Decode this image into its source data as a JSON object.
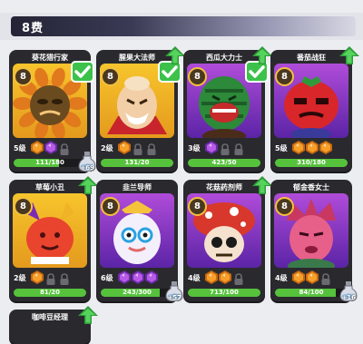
{
  "header": {
    "title": "8费"
  },
  "colors": {
    "gold_bg": "#f0b227",
    "purple_bg": "#8a3ac5",
    "green": "#3cc24a",
    "card_bg": "#2a2a2e"
  },
  "cards": [
    {
      "name": "葵花猎行家",
      "cost": "8",
      "level": "5级",
      "progress_text": "111/180",
      "progress": 0.62,
      "owned": true,
      "upgrade": false,
      "potion": "+69",
      "gems": [
        "orange",
        "purple"
      ],
      "locks": 1,
      "bg": "gold"
    },
    {
      "name": "腥果大法师",
      "cost": "8",
      "level": "2级",
      "progress_text": "131/20",
      "progress": 1.0,
      "owned": true,
      "upgrade": true,
      "potion": "",
      "gems": [
        "orange"
      ],
      "locks": 2,
      "bg": "gold"
    },
    {
      "name": "西瓜大力士",
      "cost": "8",
      "level": "3级",
      "progress_text": "423/50",
      "progress": 1.0,
      "owned": true,
      "upgrade": true,
      "potion": "",
      "gems": [
        "purple"
      ],
      "locks": 2,
      "bg": "purple"
    },
    {
      "name": "番茄战狂",
      "cost": "8",
      "level": "5级",
      "progress_text": "310/180",
      "progress": 1.0,
      "owned": false,
      "upgrade": true,
      "potion": "",
      "gems": [
        "orange",
        "orange",
        "orange"
      ],
      "locks": 0,
      "bg": "purple"
    },
    {
      "name": "草莓小丑",
      "cost": "8",
      "level": "2级",
      "progress_text": "81/20",
      "progress": 1.0,
      "owned": false,
      "upgrade": true,
      "potion": "",
      "gems": [
        "orange"
      ],
      "locks": 2,
      "bg": "gold"
    },
    {
      "name": "韭兰导师",
      "cost": "8",
      "level": "6级",
      "progress_text": "243/300",
      "progress": 0.81,
      "owned": false,
      "upgrade": false,
      "potion": "+57",
      "gems": [
        "purple",
        "purple",
        "purple"
      ],
      "locks": 0,
      "bg": "purple"
    },
    {
      "name": "花菇药剂师",
      "cost": "8",
      "level": "4级",
      "progress_text": "713/100",
      "progress": 1.0,
      "owned": false,
      "upgrade": true,
      "potion": "",
      "gems": [
        "orange",
        "orange"
      ],
      "locks": 1,
      "bg": "purple"
    },
    {
      "name": "郁金香女士",
      "cost": "8",
      "level": "4级",
      "progress_text": "84/100",
      "progress": 0.84,
      "owned": false,
      "upgrade": false,
      "potion": "+16",
      "gems": [
        "orange",
        "orange"
      ],
      "locks": 1,
      "bg": "purple"
    },
    {
      "name": "咖啡豆经理",
      "cost": "",
      "level": "",
      "progress_text": "",
      "progress": 0,
      "owned": false,
      "upgrade": true,
      "potion": "",
      "gems": [],
      "locks": 0,
      "bg": "gold"
    }
  ]
}
